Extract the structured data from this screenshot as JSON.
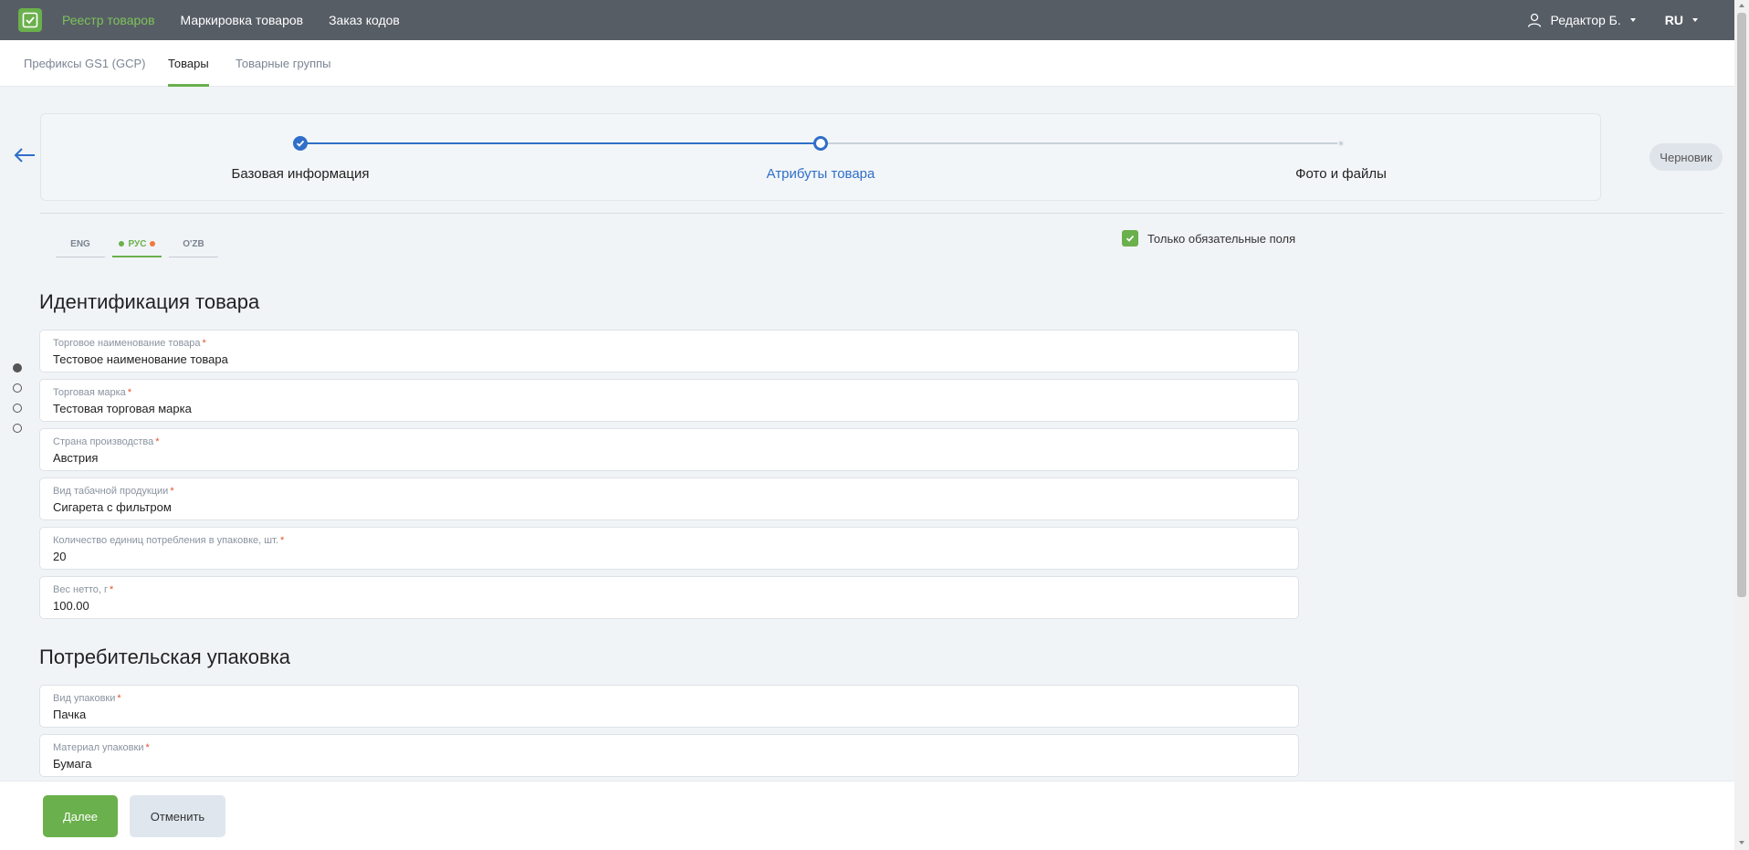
{
  "topnav": {
    "items": [
      {
        "label": "Реестр товаров"
      },
      {
        "label": "Маркировка товаров"
      },
      {
        "label": "Заказ кодов"
      }
    ],
    "user": "Редактор Б.",
    "language": "RU"
  },
  "subtabs": [
    {
      "label": "Префиксы GS1 (GCP)"
    },
    {
      "label": "Товары"
    },
    {
      "label": "Товарные группы"
    }
  ],
  "stepper": {
    "steps": [
      {
        "label": "Базовая информация",
        "state": "done"
      },
      {
        "label": "Атрибуты товара",
        "state": "current"
      },
      {
        "label": "Фото и файлы",
        "state": "pending"
      }
    ]
  },
  "status_badge": "Черновик",
  "lang_tabs": [
    {
      "label": "ENG"
    },
    {
      "label": "РУС"
    },
    {
      "label": "O'ZB"
    }
  ],
  "required_only": {
    "label": "Только обязательные поля",
    "checked": true
  },
  "sections": [
    {
      "title": "Идентификация товара",
      "fields": [
        {
          "label": "Торговое наименование товара",
          "value": "Тестовое наименование товара"
        },
        {
          "label": "Торговая марка",
          "value": "Тестовая торговая марка"
        },
        {
          "label": "Страна производства",
          "value": "Австрия"
        },
        {
          "label": "Вид табачной продукции",
          "value": "Сигарета с фильтром"
        },
        {
          "label": "Количество единиц потребления в упаковке, шт.",
          "value": "20"
        },
        {
          "label": "Вес нетто, г",
          "value": "100.00"
        }
      ]
    },
    {
      "title": "Потребительская упаковка",
      "fields": [
        {
          "label": "Вид упаковки",
          "value": "Пачка"
        },
        {
          "label": "Материал упаковки",
          "value": "Бумага"
        }
      ]
    }
  ],
  "footer": {
    "next_label": "Далее",
    "cancel_label": "Отменить"
  },
  "colors": {
    "accent": "#6ab04c",
    "topbar": "#575d65",
    "step_active": "#2f6fc9",
    "required": "#e4532d"
  }
}
